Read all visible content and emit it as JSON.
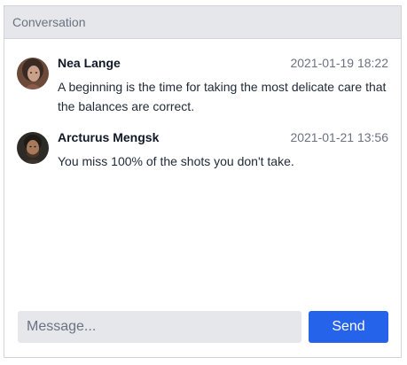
{
  "panel": {
    "title": "Conversation"
  },
  "messages": [
    {
      "author": "Nea Lange",
      "timestamp": "2021-01-19 18:22",
      "text": "A beginning is the time for taking the most delicate care that the balances are correct."
    },
    {
      "author": "Arcturus Mengsk",
      "timestamp": "2021-01-21 13:56",
      "text": "You miss 100% of the shots you don't take."
    }
  ],
  "composer": {
    "placeholder": "Message...",
    "value": "",
    "send_label": "Send"
  },
  "colors": {
    "accent": "#2563eb",
    "header_bg": "#e5e7eb",
    "input_bg": "#e5e7eb"
  }
}
